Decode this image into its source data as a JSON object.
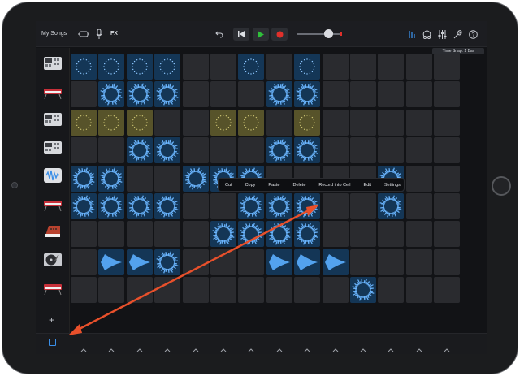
{
  "app": {
    "title": "My Songs",
    "fx_label": "FX",
    "time_snap": "Time Snap: 1 Bar"
  },
  "colors": {
    "accent_blue": "#3a8fe8",
    "cell_blue": "#143656",
    "cell_yellow": "#57532a",
    "play_green": "#2fbf3a",
    "record_red": "#e0302b",
    "arrow_red": "#e8502b"
  },
  "context_menu": {
    "items": [
      "Cut",
      "Copy",
      "Paste",
      "Delete",
      "Record into Cell",
      "Edit",
      "Settings"
    ]
  },
  "tracks": [
    {
      "icon": "drum-machine-icon"
    },
    {
      "icon": "keyboard-icon"
    },
    {
      "icon": "drum-machine-icon"
    },
    {
      "icon": "drum-machine-icon"
    },
    {
      "icon": "sampler-waveform-icon"
    },
    {
      "icon": "keyboard-icon"
    },
    {
      "icon": "synth-icon"
    },
    {
      "icon": "turntable-icon"
    },
    {
      "icon": "keyboard-icon"
    }
  ],
  "grid": {
    "columns": 14,
    "rows": [
      {
        "cells": [
          {
            "c": 0,
            "t": "dots",
            "col": "blue"
          },
          {
            "c": 1,
            "t": "dots",
            "col": "blue"
          },
          {
            "c": 2,
            "t": "dots",
            "col": "blue"
          },
          {
            "c": 3,
            "t": "dots",
            "col": "blue"
          },
          {
            "c": 6,
            "t": "dots",
            "col": "blue"
          },
          {
            "c": 8,
            "t": "dots",
            "col": "blue"
          }
        ]
      },
      {
        "cells": [
          {
            "c": 1,
            "t": "ring",
            "col": "blue"
          },
          {
            "c": 2,
            "t": "ring",
            "col": "blue"
          },
          {
            "c": 3,
            "t": "ring",
            "col": "blue"
          },
          {
            "c": 7,
            "t": "ring",
            "col": "blue"
          },
          {
            "c": 8,
            "t": "ring",
            "col": "blue"
          }
        ]
      },
      {
        "cells": [
          {
            "c": 0,
            "t": "ydots",
            "col": "yellow"
          },
          {
            "c": 1,
            "t": "ydots",
            "col": "yellow"
          },
          {
            "c": 2,
            "t": "ydots",
            "col": "yellow"
          },
          {
            "c": 5,
            "t": "ydots",
            "col": "yellow"
          },
          {
            "c": 6,
            "t": "ydots",
            "col": "yellow"
          },
          {
            "c": 8,
            "t": "ydots",
            "col": "yellow"
          }
        ]
      },
      {
        "cells": [
          {
            "c": 2,
            "t": "ring",
            "col": "blue"
          },
          {
            "c": 3,
            "t": "ring",
            "col": "blue"
          },
          {
            "c": 7,
            "t": "ring",
            "col": "blue"
          },
          {
            "c": 8,
            "t": "ring",
            "col": "blue"
          }
        ]
      },
      {
        "cells": [
          {
            "c": 0,
            "t": "ring",
            "col": "blue"
          },
          {
            "c": 1,
            "t": "ring",
            "col": "blue"
          },
          {
            "c": 4,
            "t": "ring",
            "col": "blue"
          },
          {
            "c": 5,
            "t": "ring",
            "col": "blue"
          },
          {
            "c": 6,
            "t": "ring",
            "col": "blue"
          },
          {
            "c": 11,
            "t": "ring",
            "col": "blue"
          }
        ]
      },
      {
        "cells": [
          {
            "c": 0,
            "t": "ring",
            "col": "blue"
          },
          {
            "c": 1,
            "t": "ring",
            "col": "blue"
          },
          {
            "c": 2,
            "t": "ring",
            "col": "blue"
          },
          {
            "c": 3,
            "t": "ring",
            "col": "blue"
          },
          {
            "c": 6,
            "t": "ring",
            "col": "blue"
          },
          {
            "c": 7,
            "t": "ring",
            "col": "blue"
          },
          {
            "c": 8,
            "t": "ring",
            "col": "blue"
          },
          {
            "c": 11,
            "t": "ring",
            "col": "blue"
          }
        ]
      },
      {
        "cells": [
          {
            "c": 5,
            "t": "ring",
            "col": "blue"
          },
          {
            "c": 6,
            "t": "ring",
            "col": "blue"
          },
          {
            "c": 7,
            "t": "ring",
            "col": "blue"
          },
          {
            "c": 8,
            "t": "ring",
            "col": "blue"
          }
        ]
      },
      {
        "cells": [
          {
            "c": 1,
            "t": "wave",
            "col": "blue"
          },
          {
            "c": 2,
            "t": "wave",
            "col": "blue"
          },
          {
            "c": 3,
            "t": "ring",
            "col": "blue"
          },
          {
            "c": 7,
            "t": "wave",
            "col": "blue"
          },
          {
            "c": 8,
            "t": "wave",
            "col": "blue"
          },
          {
            "c": 9,
            "t": "wave",
            "col": "blue"
          }
        ]
      },
      {
        "cells": [
          {
            "c": 10,
            "t": "ring",
            "col": "blue"
          }
        ]
      }
    ]
  }
}
